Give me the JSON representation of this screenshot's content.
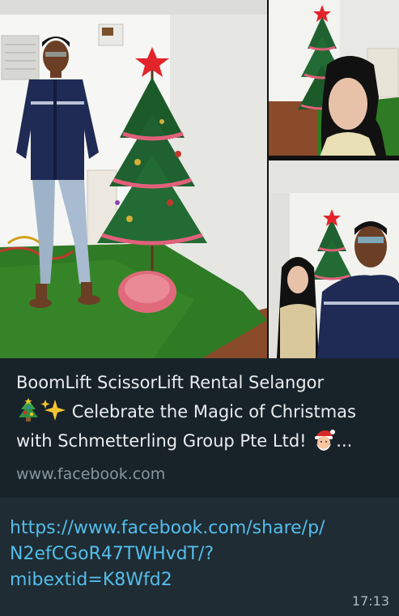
{
  "link_preview": {
    "title_line1": "BoomLift ScissorLift Rental Selangor",
    "title_line2": "Celebrate the Magic of Christmas",
    "title_line3": "with Schmetterling Group Pte Ltd!",
    "title_ellipsis": "...",
    "emoji_icons": [
      "christmas-tree-icon",
      "sparkles-icon",
      "santa-icon"
    ],
    "domain": "www.facebook.com"
  },
  "message": {
    "link_line1": "https://www.facebook.com/share/p/",
    "link_line2": "N2efCGoR47TWHvdT/?",
    "link_line3": "mibextid=K8Wfd2",
    "time": "17:13"
  },
  "colors": {
    "bubble_bg": "#1f2c33",
    "preview_bg": "#182329",
    "text_primary": "#e9edef",
    "text_secondary": "#8696a0",
    "link": "#53bdeb"
  }
}
